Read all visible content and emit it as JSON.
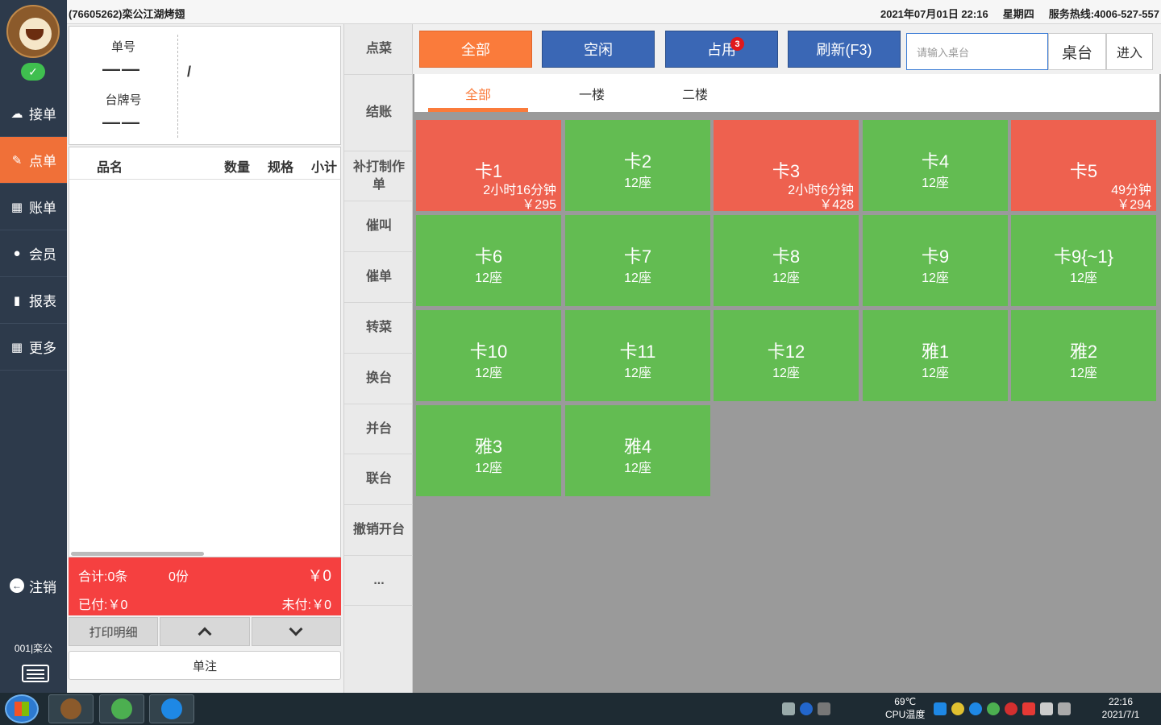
{
  "titlebar": {
    "app_title": "(76605262)栾公江湖烤翅",
    "datetime": "2021年07月01日 22:16",
    "weekday": "星期四",
    "hotline": "服务热线:4006-527-557"
  },
  "sidebar": {
    "items": [
      {
        "label": "接单",
        "icon": "cloud-upload-icon"
      },
      {
        "label": "点单",
        "icon": "edit-icon"
      },
      {
        "label": "账单",
        "icon": "grid-list-icon"
      },
      {
        "label": "会员",
        "icon": "user-icon"
      },
      {
        "label": "报表",
        "icon": "bar-chart-icon"
      },
      {
        "label": "更多",
        "icon": "tiles-icon"
      }
    ],
    "active_index": 1,
    "logout_label": "注销",
    "user_code": "001|栾公"
  },
  "order": {
    "order_no_label": "单号",
    "order_no_value": "——",
    "table_card_label": "台牌号",
    "table_card_value": "——",
    "slash": "/",
    "columns": [
      "品名",
      "数量",
      "规格",
      "小计"
    ],
    "totals": {
      "count_text": "合计:0条",
      "portions_text": "0份",
      "amount_text": "￥0",
      "paid_text": "已付:￥0",
      "unpaid_text": "未付:￥0"
    },
    "print_detail_label": "打印明细",
    "note_label": "单注"
  },
  "actions": [
    "点菜",
    "结账",
    "补打制作单",
    "催叫",
    "催单",
    "转菜",
    "换台",
    "并台",
    "联台",
    "撤销开台",
    "..."
  ],
  "filters": {
    "all_label": "全部",
    "free_label": "空闲",
    "busy_label": "占用",
    "busy_count": "3",
    "refresh_label": "刷新(F3)",
    "search_placeholder": "请输入桌台",
    "table_label": "桌台",
    "enter_label": "进入"
  },
  "floors": [
    "全部",
    "一楼",
    "二楼"
  ],
  "tables": [
    {
      "name": "卡1",
      "status": "busy",
      "duration": "2小时16分钟",
      "amount": "￥295"
    },
    {
      "name": "卡2",
      "status": "free",
      "seats": "12座"
    },
    {
      "name": "卡3",
      "status": "busy",
      "duration": "2小时6分钟",
      "amount": "￥428"
    },
    {
      "name": "卡4",
      "status": "free",
      "seats": "12座"
    },
    {
      "name": "卡5",
      "status": "busy",
      "duration": "49分钟",
      "amount": "￥294"
    },
    {
      "name": "卡6",
      "status": "free",
      "seats": "12座"
    },
    {
      "name": "卡7",
      "status": "free",
      "seats": "12座"
    },
    {
      "name": "卡8",
      "status": "free",
      "seats": "12座"
    },
    {
      "name": "卡9",
      "status": "free",
      "seats": "12座"
    },
    {
      "name": "卡9{~1}",
      "status": "free",
      "seats": "12座"
    },
    {
      "name": "卡10",
      "status": "free",
      "seats": "12座"
    },
    {
      "name": "卡11",
      "status": "free",
      "seats": "12座"
    },
    {
      "name": "卡12",
      "status": "free",
      "seats": "12座"
    },
    {
      "name": "雅1",
      "status": "free",
      "seats": "12座"
    },
    {
      "name": "雅2",
      "status": "free",
      "seats": "12座"
    },
    {
      "name": "雅3",
      "status": "free",
      "seats": "12座"
    },
    {
      "name": "雅4",
      "status": "free",
      "seats": "12座"
    }
  ],
  "colors": {
    "free": "#63bc52",
    "busy": "#ee614f",
    "accent": "#fa7b3b",
    "blue": "#3a67b5",
    "sidebar": "#2d3a4b"
  },
  "taskbar": {
    "cpu_temp": "69℃",
    "cpu_label": "CPU温度",
    "time": "22:16",
    "date": "2021/7/1"
  }
}
